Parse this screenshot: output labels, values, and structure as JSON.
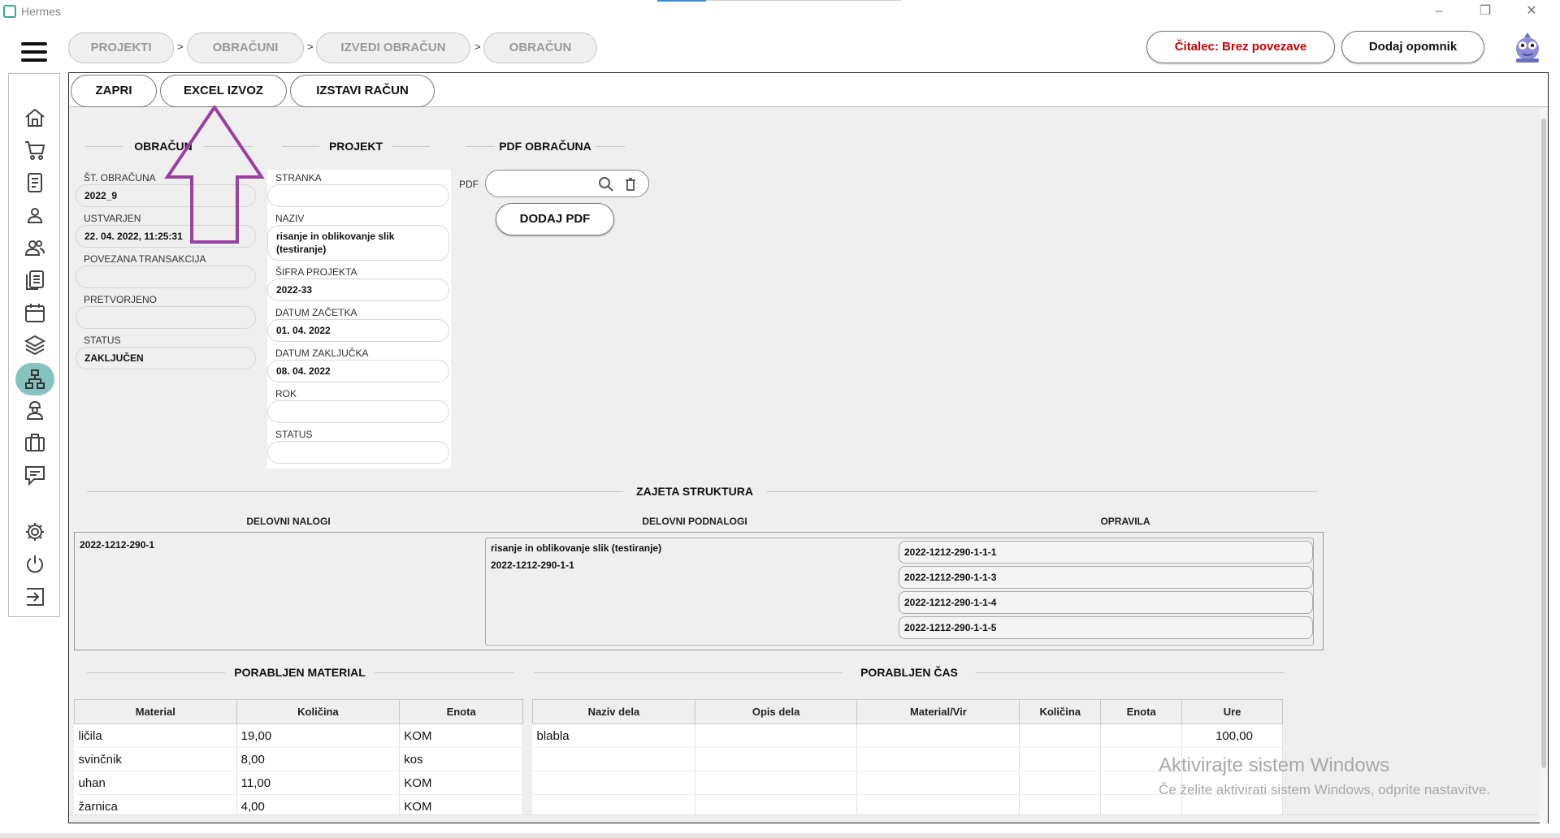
{
  "window": {
    "title": "Hermes",
    "controls": {
      "minimize": "–",
      "maximize": "❐",
      "close": "✕"
    }
  },
  "breadcrumb": {
    "items": [
      "PROJEKTI",
      "OBRAČUNI",
      "IZVEDI OBRAČUN",
      "OBRAČUN"
    ],
    "separator": ">"
  },
  "header": {
    "reader_status": "Čitalec: Brez povezave",
    "reminder_button": "Dodaj opomnik"
  },
  "colors": {
    "accent": "#86c2c0",
    "danger": "#cc0000",
    "annotation_arrow": "#9b3fa3"
  },
  "sidebar": {
    "icons": [
      "home-icon",
      "cart-icon",
      "document-icon",
      "user-icon",
      "users-icon",
      "documents-icon",
      "calendar-icon",
      "layers-icon",
      "hierarchy-icon",
      "worker-icon",
      "briefcase-icon",
      "chat-icon",
      "gear-icon",
      "power-icon",
      "logout-icon"
    ],
    "active": "hierarchy-icon"
  },
  "actions": {
    "close": "ZAPRI",
    "excel_export": "EXCEL IZVOZ",
    "issue_invoice": "IZSTAVI RAČUN"
  },
  "obracun": {
    "title": "OBRAČUN",
    "number_label": "ŠT. OBRAČUNA",
    "number": "2022_9",
    "created_label": "USTVARJEN",
    "created": "22. 04. 2022, 11:25:31",
    "transaction_label": "POVEZANA TRANSAKCIJA",
    "transaction": "",
    "converted_label": "PRETVORJENO",
    "converted": "",
    "status_label": "STATUS",
    "status": "ZAKLJUČEN"
  },
  "projekt": {
    "title": "PROJEKT",
    "client_label": "STRANKA",
    "client": "",
    "name_label": "NAZIV",
    "name": "risanje in oblikovanje slik (testiranje)",
    "code_label": "ŠIFRA PROJEKTA",
    "code": "2022-33",
    "start_label": "DATUM ZAČETKA",
    "start": "01. 04. 2022",
    "end_label": "DATUM ZAKLJUČKA",
    "end": "08. 04. 2022",
    "deadline_label": "ROK",
    "deadline": "",
    "status_label": "STATUS",
    "status": ""
  },
  "pdf": {
    "title": "PDF OBRAČUNA",
    "label": "PDF",
    "value": "",
    "add_button": "DODAJ PDF"
  },
  "structure": {
    "title": "ZAJETA STRUKTURA",
    "col_orders": "DELOVNI NALOGI",
    "col_suborders": "DELOVNI PODNALOGI",
    "col_tasks": "OPRAVILA",
    "order": "2022-1212-290-1",
    "suborder_name": "risanje in oblikovanje slik (testiranje)",
    "suborder_code": "2022-1212-290-1-1",
    "tasks": [
      "2022-1212-290-1-1-1",
      "2022-1212-290-1-1-3",
      "2022-1212-290-1-1-4",
      "2022-1212-290-1-1-5"
    ]
  },
  "material": {
    "title": "PORABLJEN MATERIAL",
    "headers": [
      "Material",
      "Količina",
      "Enota"
    ],
    "rows": [
      [
        "ličila",
        "19,00",
        "KOM"
      ],
      [
        "svinčnik",
        "8,00",
        "kos"
      ],
      [
        "uhan",
        "11,00",
        "KOM"
      ],
      [
        "žarnica",
        "4,00",
        "KOM"
      ]
    ]
  },
  "time": {
    "title": "PORABLJEN ČAS",
    "headers": [
      "Naziv dela",
      "Opis dela",
      "Material/Vir",
      "Količina",
      "Enota",
      "Ure"
    ],
    "rows": [
      [
        "blabla",
        "",
        "",
        "",
        "",
        "100,00"
      ],
      [
        "",
        "",
        "",
        "",
        "",
        ""
      ],
      [
        "",
        "",
        "",
        "",
        "",
        ""
      ],
      [
        "",
        "",
        "",
        "",
        "",
        ""
      ]
    ]
  },
  "watermark": {
    "line1": "Aktivirajte sistem Windows",
    "line2": "Če želite aktivirati sistem Windows, odprite nastavitve."
  }
}
